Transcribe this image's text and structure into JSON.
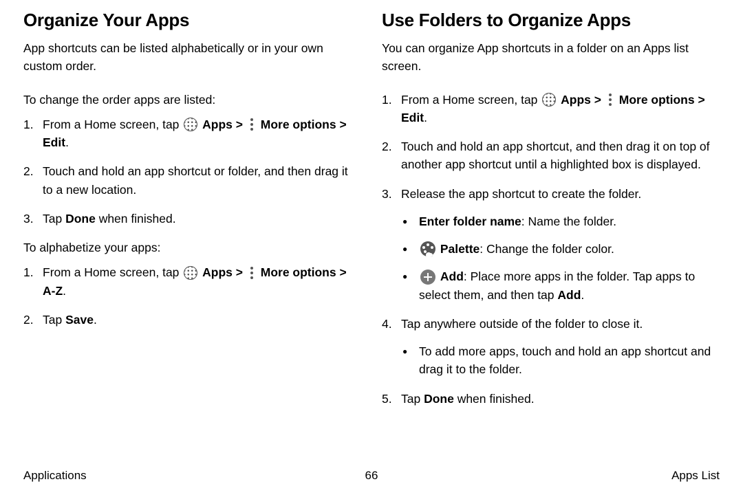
{
  "left": {
    "heading": "Organize Your Apps",
    "intro": "App shortcuts can be listed alphabetically or in your own custom order.",
    "lead1": "To change the order apps are listed:",
    "step1_pre": "From a Home screen, tap ",
    "apps_label": "Apps",
    "chev": " > ",
    "more_label": "More options",
    "step1_post": "Edit",
    "step1_dot": ".",
    "step2": "Touch and hold an app shortcut or folder, and then drag it to a new location.",
    "step3_pre": "Tap ",
    "step3_bold": "Done",
    "step3_post": " when finished.",
    "lead2": "To alphabetize your apps:",
    "b_step1_post": "A-Z",
    "b_step2_pre": "Tap ",
    "b_step2_bold": "Save",
    "b_step2_post": "."
  },
  "right": {
    "heading": "Use Folders to Organize Apps",
    "intro": "You can organize App shortcuts in a folder on an Apps list screen.",
    "step1_post": "Edit",
    "step2": "Touch and hold an app shortcut, and then drag it on top of another app shortcut until a highlighted box is displayed.",
    "step3": "Release the app shortcut to create the folder.",
    "b1_bold": "Enter folder name",
    "b1_rest": ": Name the folder.",
    "b2_bold": "Palette",
    "b2_rest": ": Change the folder color.",
    "b3_bold": "Add",
    "b3_rest_a": ": Place more apps in the folder. Tap apps to select them, and then tap ",
    "b3_rest_bold": "Add",
    "b3_rest_b": ".",
    "step4": "Tap anywhere outside of the folder to close it.",
    "b4": "To add more apps, touch and hold an app shortcut and drag it to the folder.",
    "step5_pre": "Tap ",
    "step5_bold": "Done",
    "step5_post": " when finished."
  },
  "footer": {
    "left": "Applications",
    "center": "66",
    "right": "Apps List"
  }
}
